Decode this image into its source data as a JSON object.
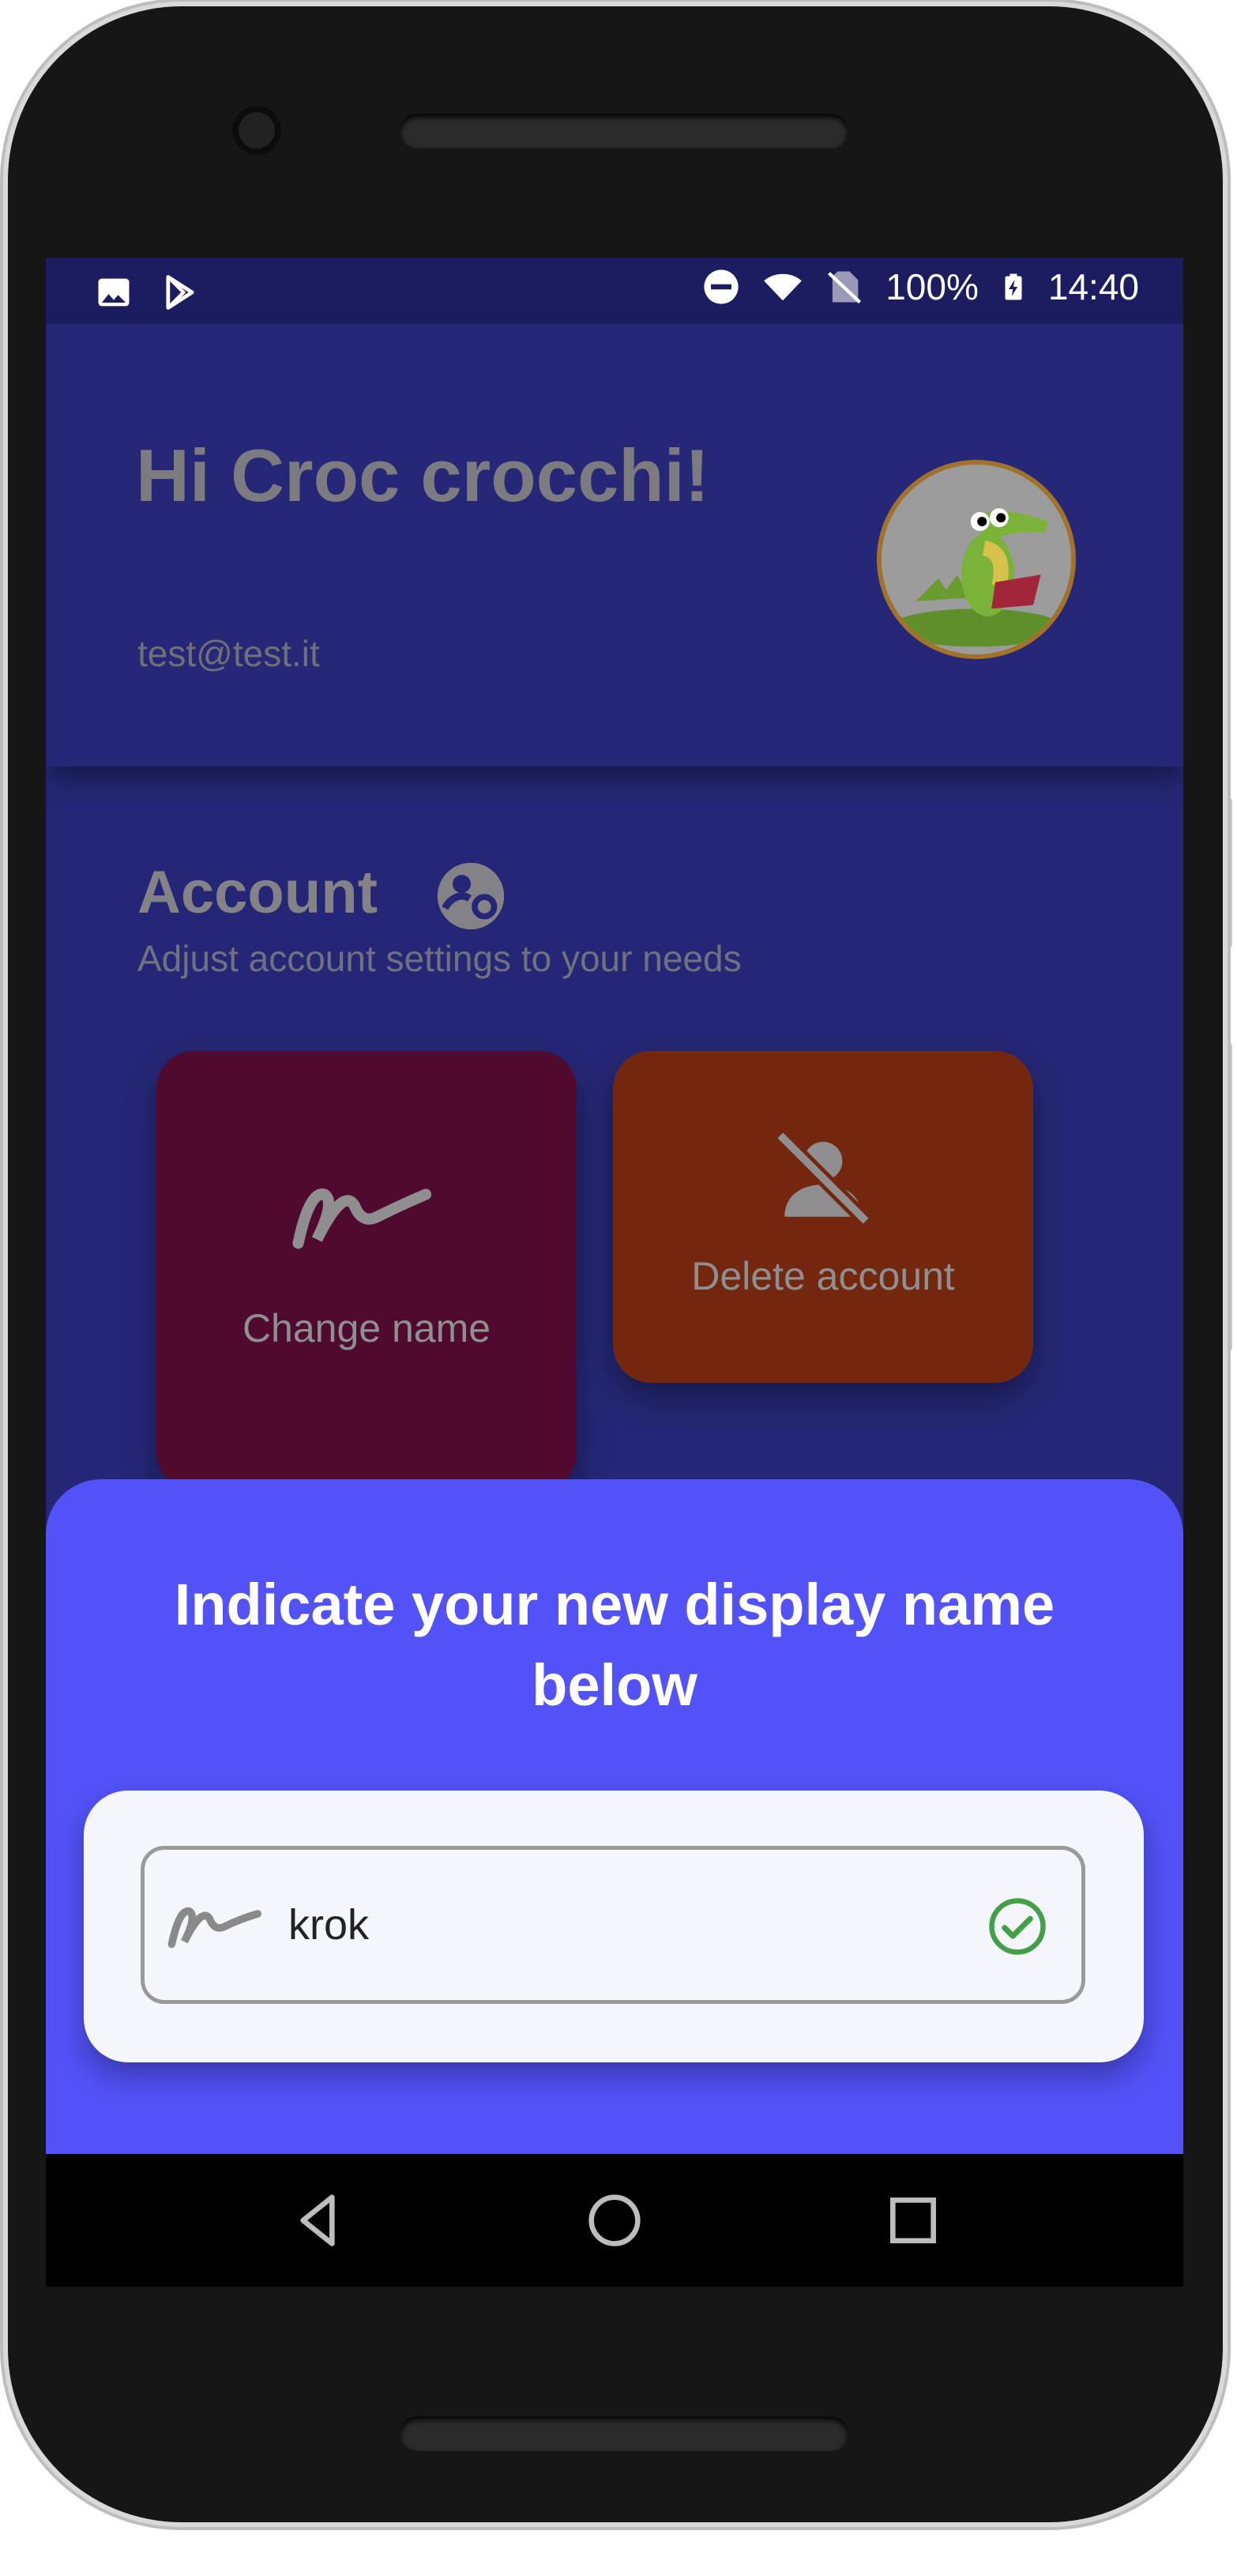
{
  "status_bar": {
    "battery": "100%",
    "time": "14:40",
    "left_icons": [
      "gallery-icon",
      "play-store-icon"
    ],
    "right_icons": [
      "do-not-disturb-icon",
      "wifi-icon",
      "no-sim-icon",
      "battery-charging-icon"
    ]
  },
  "header": {
    "greeting": "Hi Croc crocchi!",
    "email": "test@test.it",
    "avatar_icon": "crocodile-avatar"
  },
  "account": {
    "title": "Account",
    "title_icon": "account-settings-icon",
    "subtitle": "Adjust account settings to your needs",
    "tiles": [
      {
        "label": "Change name",
        "icon": "signature-icon",
        "color": "#4f0a2d"
      },
      {
        "label": "Delete account",
        "icon": "person-off-icon",
        "color": "#73270f"
      }
    ]
  },
  "dialog": {
    "title": "Indicate your new display name below",
    "input_value": "krok",
    "input_icon": "signature-icon",
    "valid_icon": "check-circle-icon",
    "accent": "#5252f8",
    "valid_color": "#43a047"
  },
  "nav_bar": {
    "buttons": [
      "back-icon",
      "home-icon",
      "recents-icon"
    ]
  }
}
